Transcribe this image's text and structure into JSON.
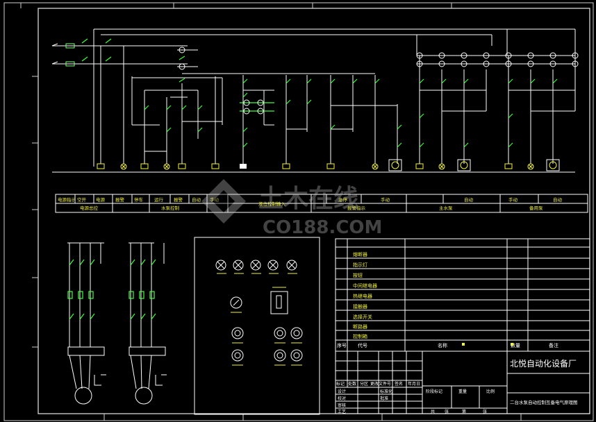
{
  "legend_strip": {
    "row1": [
      "电源指示",
      "空开",
      "电源",
      "报警",
      "停车",
      "运行",
      "报警",
      "自动",
      "手动",
      "急停",
      "手动",
      "自动",
      "手动",
      "自动"
    ],
    "row2": [
      "电源总控",
      "水泵控制",
      "液位控制输入",
      "报警指示",
      "主水泵",
      "备用泵"
    ]
  },
  "parts_list": {
    "rows": [
      "熔断器",
      "指示灯",
      "按钮",
      "中间继电器",
      "热继电器",
      "接触器",
      "选择开关",
      "断路器",
      "控制箱"
    ],
    "header": {
      "index": "序号",
      "code": "代号",
      "name": "名称",
      "qty": "数量",
      "note": "备注"
    }
  },
  "title_block": {
    "company": "北悦自动化设备厂",
    "drawing_title": "二台水泵自动控制互备电气原理图",
    "row_labels": [
      "标记",
      "处数",
      "分区",
      "更改文件号",
      "签名",
      "年月日"
    ],
    "sign_labels": [
      "设计",
      "校对",
      "审核",
      "工艺",
      "标准化",
      "批准"
    ],
    "right_labels": [
      "阶段标记",
      "重量",
      "比例"
    ],
    "bottom_labels": [
      "共",
      "张",
      "第",
      "张"
    ]
  },
  "watermark": {
    "brand": "土木在线",
    "site": "CO188.COM"
  }
}
